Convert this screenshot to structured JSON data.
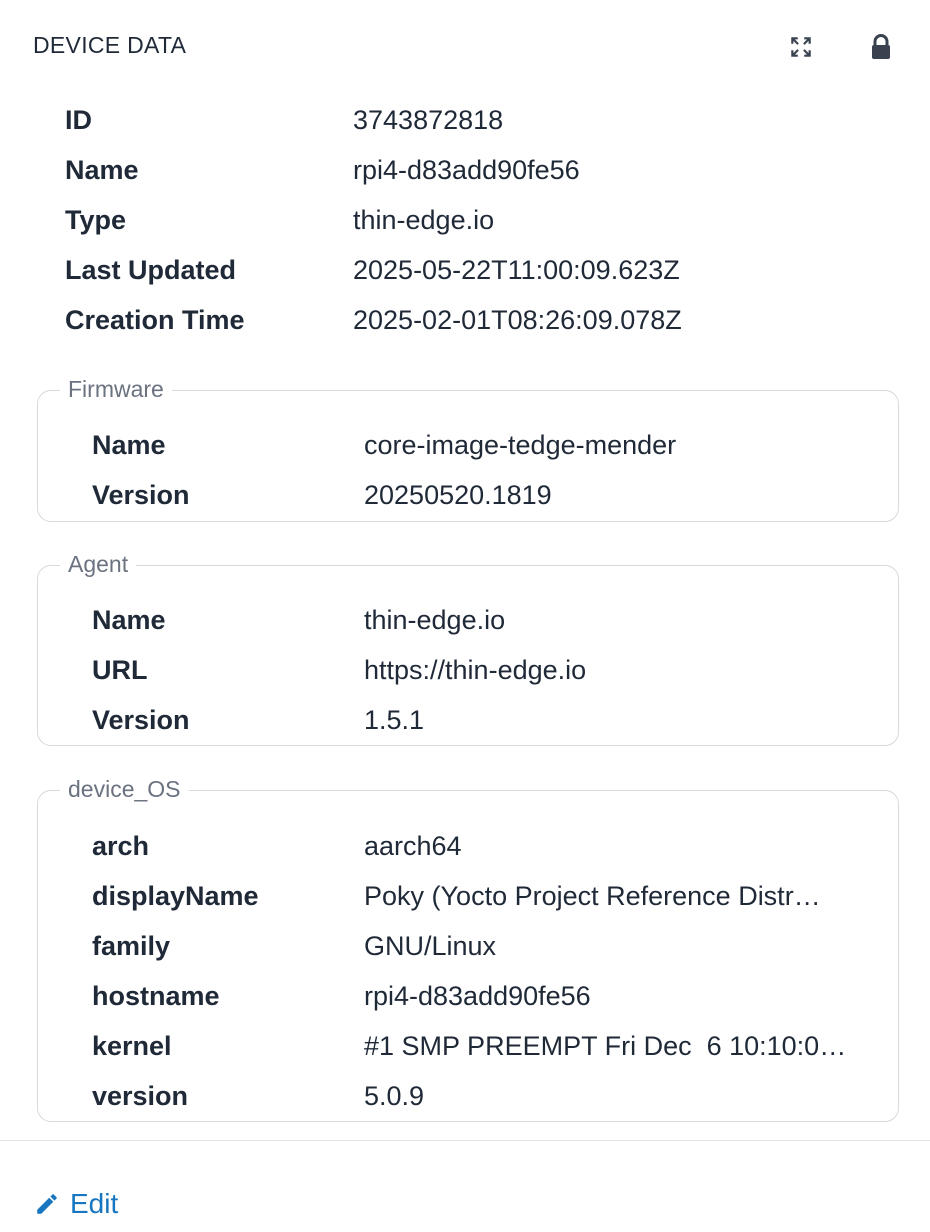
{
  "header": {
    "title": "DEVICE DATA",
    "expand_icon": "expand-icon",
    "lock_icon": "lock-icon"
  },
  "device": {
    "fields": [
      {
        "label": "ID",
        "value": "3743872818"
      },
      {
        "label": "Name",
        "value": "rpi4-d83add90fe56"
      },
      {
        "label": "Type",
        "value": "thin-edge.io"
      },
      {
        "label": "Last Updated",
        "value": "2025-05-22T11:00:09.623Z"
      },
      {
        "label": "Creation Time",
        "value": "2025-02-01T08:26:09.078Z"
      }
    ]
  },
  "firmware": {
    "legend": "Firmware",
    "fields": [
      {
        "label": "Name",
        "value": "core-image-tedge-mender"
      },
      {
        "label": "Version",
        "value": "20250520.1819"
      }
    ]
  },
  "agent": {
    "legend": "Agent",
    "fields": [
      {
        "label": "Name",
        "value": "thin-edge.io"
      },
      {
        "label": "URL",
        "value": "https://thin-edge.io"
      },
      {
        "label": "Version",
        "value": "1.5.1"
      }
    ]
  },
  "device_os": {
    "legend": "device_OS",
    "fields": [
      {
        "label": "arch",
        "value": "aarch64"
      },
      {
        "label": "displayName",
        "value": "Poky (Yocto Project Reference Distr…"
      },
      {
        "label": "family",
        "value": "GNU/Linux"
      },
      {
        "label": "hostname",
        "value": "rpi4-d83add90fe56"
      },
      {
        "label": "kernel",
        "value": "#1 SMP PREEMPT Fri Dec  6 10:10:0…"
      },
      {
        "label": "version",
        "value": "5.0.9"
      }
    ]
  },
  "footer": {
    "edit_label": "Edit",
    "edit_icon": "pencil-icon"
  },
  "colors": {
    "text": "#1f2937",
    "muted": "#6b7280",
    "border": "#d6d9de",
    "link": "#1776bf",
    "icon": "#3a4250"
  }
}
